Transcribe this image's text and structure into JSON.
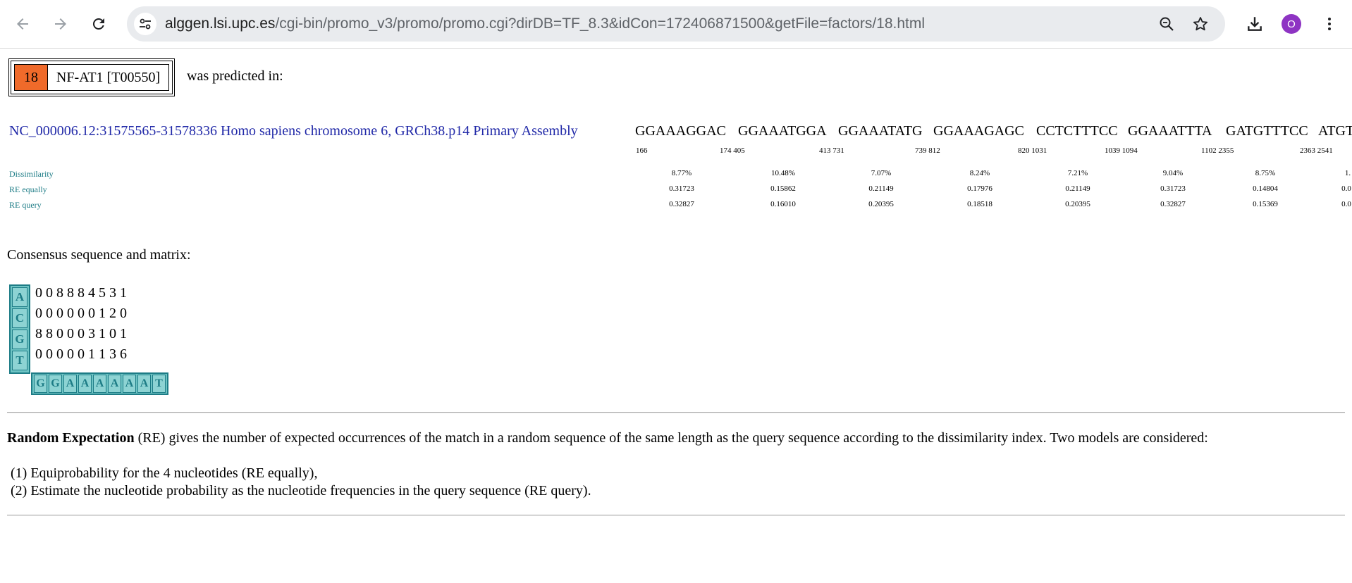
{
  "browser": {
    "url_host": "alggen.lsi.upc.es",
    "url_path": "/cgi-bin/promo_v3/promo/promo.cgi?dirDB=TF_8.3&idCon=172406871500&getFile=factors/18.html",
    "avatar_letter": "O",
    "avatar_color": "#8e34c3"
  },
  "factor": {
    "number": "18",
    "name": "NF-AT1 [T00550]",
    "predicted_text": "was predicted in:",
    "number_color": "#f06a2a"
  },
  "sequence": {
    "link_text": "NC_000006.12:31575565-31578336 Homo sapiens chromosome 6, GRCh38.p14 Primary Assembly",
    "sites": [
      "GGAAAGGAC",
      "GGAAATGGA",
      "GGAAATATG",
      "GGAAAGAGC",
      "CCTCTTTCC",
      "GGAAATTTA",
      "GATGTTTCC",
      "ATGT"
    ],
    "positions": [
      "166",
      "174 405",
      "413 731",
      "739 812",
      "820 1031",
      "1039 1094",
      "1102 2355",
      "2363 2541"
    ]
  },
  "metrics": {
    "labels": [
      "Dissimilarity",
      "RE equally",
      "RE query"
    ],
    "dissimilarity": [
      "8.77%",
      "10.48%",
      "7.07%",
      "8.24%",
      "7.21%",
      "9.04%",
      "8.75%",
      "1."
    ],
    "re_equally": [
      "0.31723",
      "0.15862",
      "0.21149",
      "0.17976",
      "0.21149",
      "0.31723",
      "0.14804",
      "0.0"
    ],
    "re_query": [
      "0.32827",
      "0.16010",
      "0.20395",
      "0.18518",
      "0.20395",
      "0.32827",
      "0.15369",
      "0.0"
    ]
  },
  "consensus": {
    "title": "Consensus sequence and matrix:",
    "bases": [
      "A",
      "C",
      "G",
      "T"
    ],
    "matrix": [
      "0 0 8 8 8 4 5 3 1",
      "0 0 0 0 0 0 1 2 0",
      "8 8 0 0 0 3 1 0 1",
      "0 0 0 0 0 1 1 3 6"
    ],
    "sequence": [
      "G",
      "G",
      "A",
      "A",
      "A",
      "A",
      "A",
      "A",
      "T"
    ],
    "accent_color": "#1d7c86",
    "cell_color": "#8dd3d3"
  },
  "random_expectation": {
    "bold": "Random Expectation",
    "text": " (RE) gives the number of expected occurrences of the match in a random sequence of the same length as the query sequence according to the dissimilarity index. Two models are considered:",
    "item1": "(1) Equiprobability for the 4 nucleotides (RE equally),",
    "item2": "(2) Estimate the nucleotide probability as the nucleotide frequencies in the query sequence (RE query)."
  }
}
